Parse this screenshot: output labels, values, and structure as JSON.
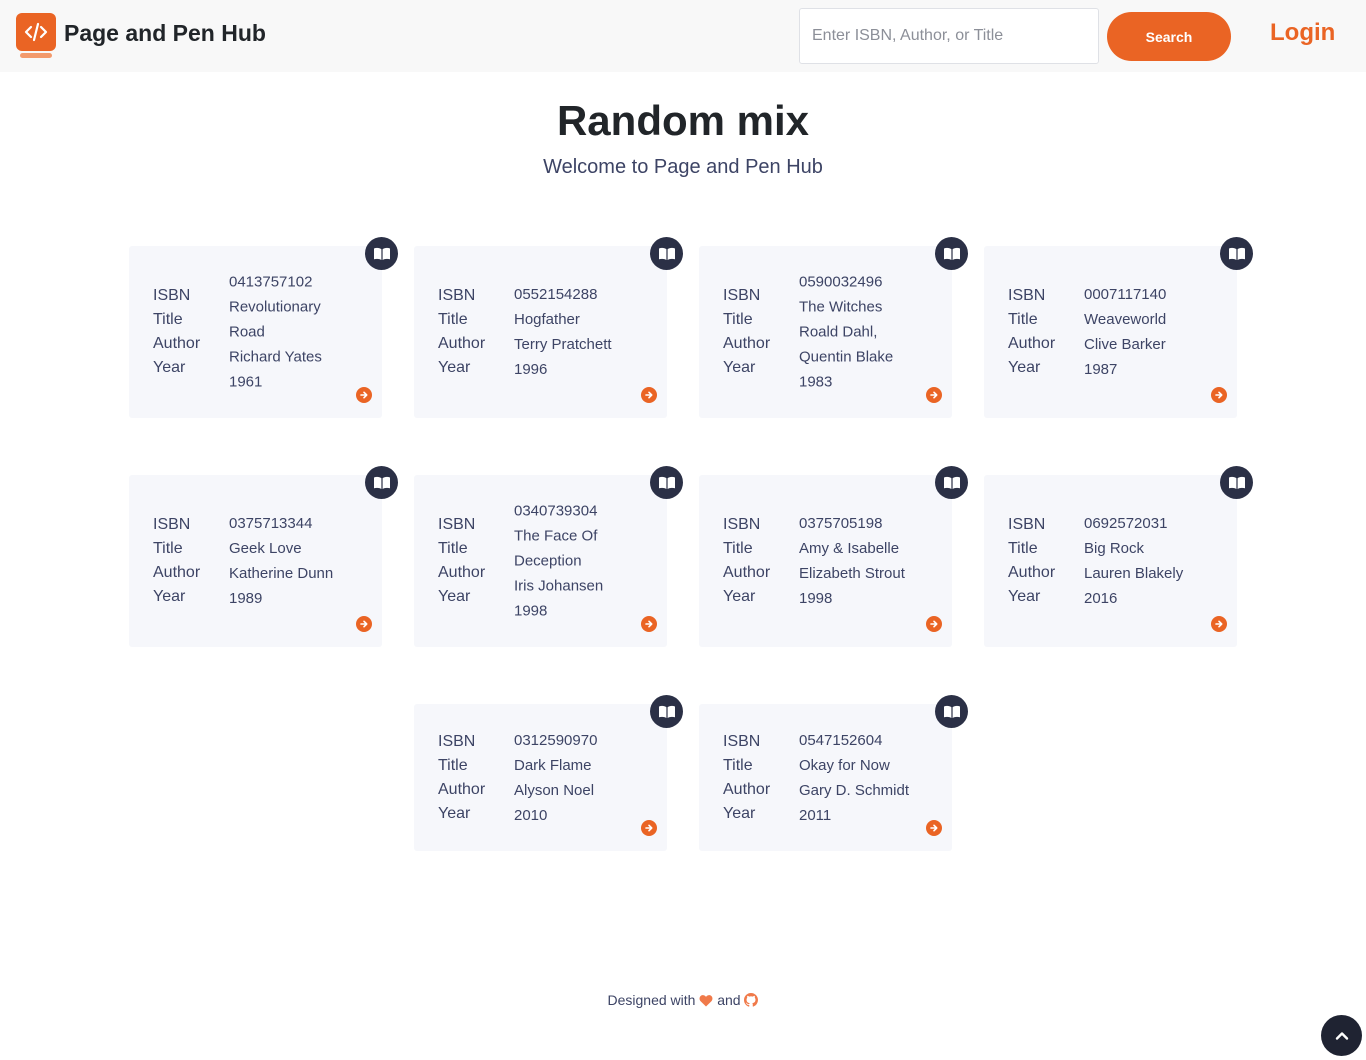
{
  "header": {
    "brand": "Page and Pen Hub",
    "logo_icon": "code-book-icon",
    "search_placeholder": "Enter ISBN, Author, or Title",
    "search_label": "Search",
    "login_label": "Login"
  },
  "hero": {
    "title": "Random mix",
    "subtitle": "Welcome to Page and Pen Hub"
  },
  "labels": {
    "isbn": "ISBN",
    "title": "Title",
    "author": "Author",
    "year": "Year"
  },
  "books": [
    {
      "isbn": "0413757102",
      "title": "Revolutionary Road",
      "author": "Richard Yates",
      "year": "1961"
    },
    {
      "isbn": "0552154288",
      "title": "Hogfather",
      "author": "Terry Pratchett",
      "year": "1996"
    },
    {
      "isbn": "0590032496",
      "title": "The Witches",
      "author": "Roald Dahl, Quentin Blake",
      "year": "1983"
    },
    {
      "isbn": "0007117140",
      "title": "Weaveworld",
      "author": "Clive Barker",
      "year": "1987"
    },
    {
      "isbn": "0375713344",
      "title": "Geek Love",
      "author": "Katherine Dunn",
      "year": "1989"
    },
    {
      "isbn": "0340739304",
      "title": "The Face Of Deception",
      "author": "Iris Johansen",
      "year": "1998"
    },
    {
      "isbn": "0375705198",
      "title": "Amy & Isabelle",
      "author": "Elizabeth Strout",
      "year": "1998"
    },
    {
      "isbn": "0692572031",
      "title": "Big Rock",
      "author": "Lauren Blakely",
      "year": "2016"
    },
    {
      "isbn": "0312590970",
      "title": "Dark Flame",
      "author": "Alyson Noel",
      "year": "2010"
    },
    {
      "isbn": "0547152604",
      "title": "Okay for Now",
      "author": "Gary D. Schmidt",
      "year": "2011"
    }
  ],
  "footer": {
    "designed_with": "Designed with",
    "and": "and",
    "heart_icon": "heart-icon",
    "github_icon": "github-icon"
  },
  "colors": {
    "accent": "#ea6424",
    "dark": "#2b3046",
    "card_bg": "#f6f7fb"
  }
}
